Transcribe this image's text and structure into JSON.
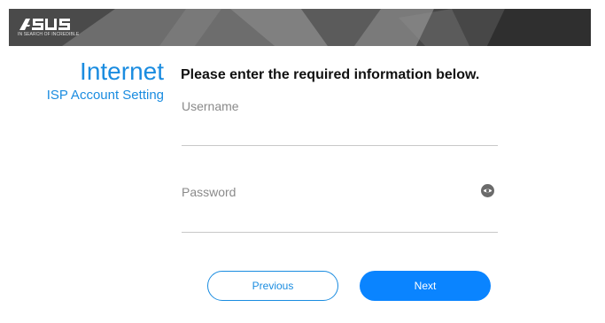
{
  "banner": {
    "brand": "ASUS",
    "tagline": "IN SEARCH OF INCREDIBLE"
  },
  "header": {
    "title": "Internet",
    "subtitle": "ISP Account Setting"
  },
  "form": {
    "heading": "Please enter the required information below.",
    "username": {
      "placeholder": "Username",
      "value": ""
    },
    "password": {
      "placeholder": "Password",
      "value": ""
    }
  },
  "buttons": {
    "previous_label": "Previous",
    "next_label": "Next"
  },
  "icons": {
    "password_toggle": "eye-icon"
  },
  "colors": {
    "accent": "#1a8ce0",
    "primary_button": "#0a84ff"
  }
}
